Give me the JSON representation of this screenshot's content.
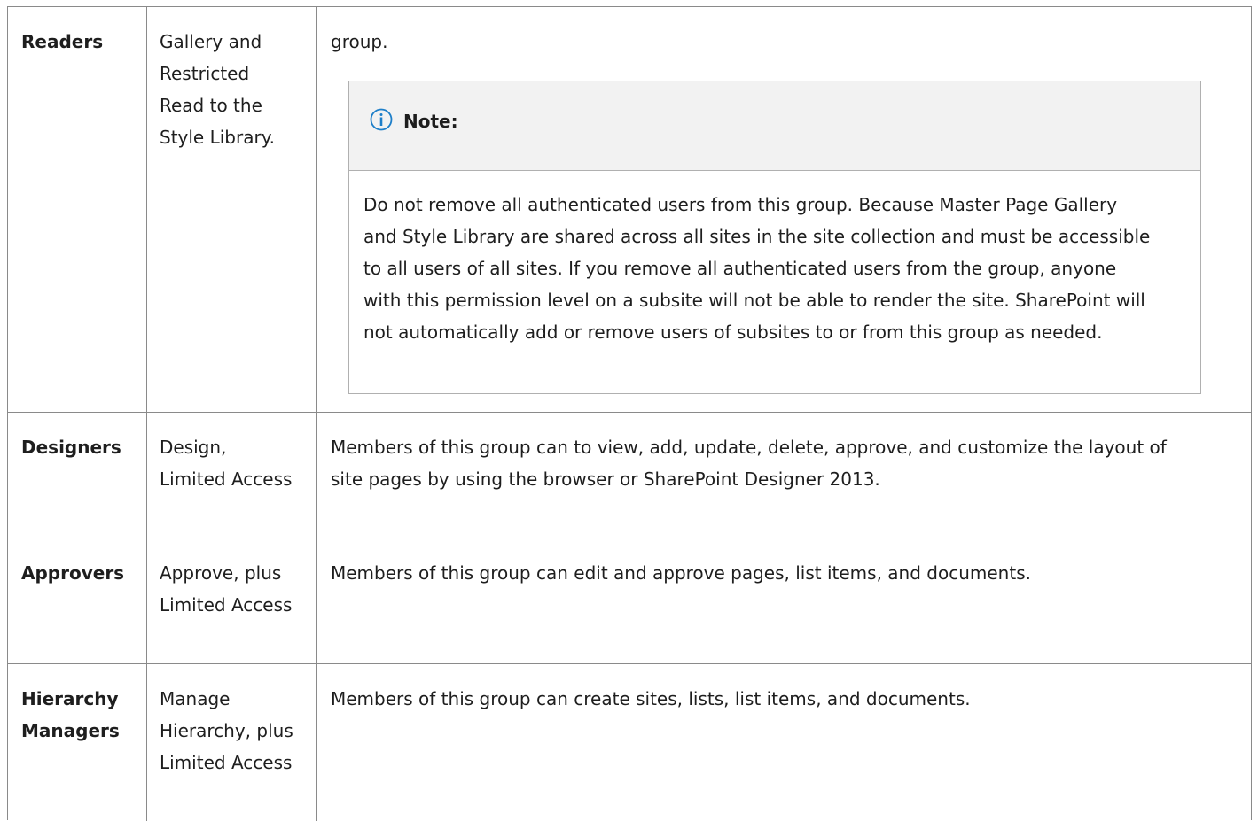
{
  "rows": [
    {
      "group": "Readers",
      "permission": "Gallery and\nRestricted\nRead to the\nStyle Library.",
      "description": "group."
    },
    {
      "group": "Designers",
      "permission": "Design,\nLimited Access",
      "description": "Members of this group can to view, add, update, delete, approve, and customize the layout of\nsite pages by using the browser or SharePoint Designer 2013."
    },
    {
      "group": "Approvers",
      "permission": "Approve, plus\nLimited Access",
      "description": "Members of this group can edit and approve pages, list items, and documents."
    },
    {
      "group": "Hierarchy\nManagers",
      "permission": "Manage\nHierarchy, plus\nLimited Access",
      "description": "Members of this group can create sites, lists, list items, and documents."
    }
  ],
  "note": {
    "icon": "info-icon",
    "title": "Note:",
    "body": "Do not remove all authenticated users from this group. Because Master Page Gallery\nand Style Library are shared across all sites in the site collection and must be accessible\nto all users of all sites. If you remove all authenticated users from the group, anyone\nwith this permission level on a subsite will not be able to render the site. SharePoint will\nnot automatically add or remove users of subsites to or from this group as needed."
  },
  "colors": {
    "border": "#8a8a8a",
    "note_header_bg": "#f2f2f2",
    "info_icon": "#1e7fc9"
  }
}
